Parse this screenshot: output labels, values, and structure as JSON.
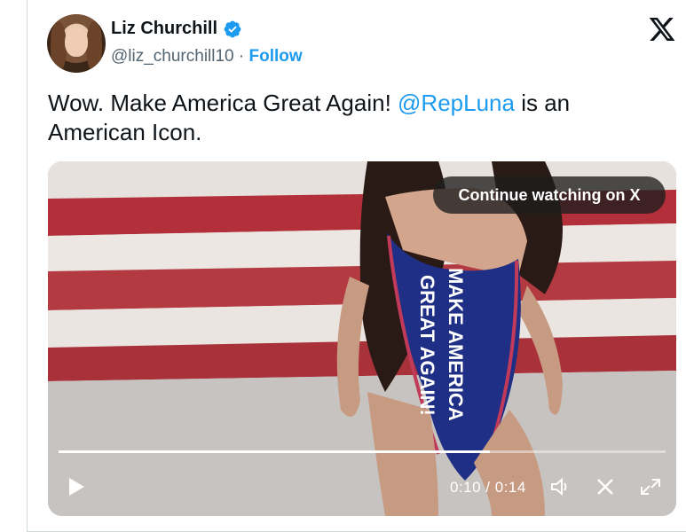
{
  "author": {
    "name": "Liz Churchill",
    "handle": "@liz_churchill10",
    "separator": " · ",
    "follow_label": "Follow",
    "verified_color": "#1d9bf0"
  },
  "tweet": {
    "text_before": "Wow. Make America Great Again! ",
    "mention": "@RepLuna",
    "text_after": " is an American Icon."
  },
  "video": {
    "continue_label": "Continue watching on X",
    "time": "0:10 / 0:14",
    "progress": 0.71,
    "swimsuit_text_line1": "MAKE AMERICA",
    "swimsuit_text_line2": "GREAT AGAIN!"
  },
  "colors": {
    "accent": "#1d9bf0",
    "flag_red": "#b3303a",
    "flag_white": "#ece7e3",
    "swimsuit_blue": "#1f2f86"
  },
  "icons": {
    "x_logo": "x-logo-icon",
    "verified": "verified-badge-icon",
    "play": "play-icon",
    "volume": "volume-icon",
    "close": "close-icon",
    "fullscreen": "fullscreen-icon"
  }
}
